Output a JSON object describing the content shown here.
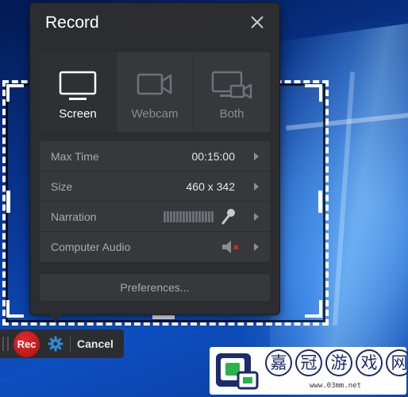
{
  "panel": {
    "title": "Record",
    "modes": [
      {
        "label": "Screen",
        "icon": "monitor-icon",
        "active": true
      },
      {
        "label": "Webcam",
        "icon": "webcam-icon",
        "active": false
      },
      {
        "label": "Both",
        "icon": "monitor-webcam-icon",
        "active": false
      }
    ],
    "settings": {
      "max_time": {
        "label": "Max Time",
        "value": "00:15:00"
      },
      "size": {
        "label": "Size",
        "value": "460 x 342"
      },
      "narration": {
        "label": "Narration",
        "icon": "microphone-icon"
      },
      "computer_audio": {
        "label": "Computer Audio",
        "icon": "speaker-muted-icon"
      }
    },
    "preferences_label": "Preferences..."
  },
  "toolbar": {
    "rec_label": "Rec",
    "cancel_label": "Cancel"
  },
  "watermark": {
    "chars": [
      "嘉",
      "冠",
      "游",
      "戏",
      "网"
    ],
    "url": "www.03mm.net"
  },
  "colors": {
    "panel_bg": "#2b2d30",
    "row_bg": "#36383b",
    "rec_red": "#c81a1a",
    "gear_blue": "#2d8cd6",
    "desktop_blue": "#0d4fc0"
  }
}
